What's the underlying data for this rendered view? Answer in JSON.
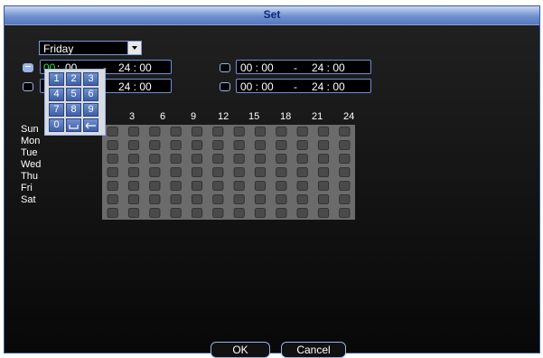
{
  "window": {
    "title": "Set"
  },
  "day_select": {
    "value": "Friday"
  },
  "periods": [
    {
      "enabled": true,
      "start_hour": "00",
      "start_min": "00",
      "sep": "-",
      "end": "24 : 00"
    },
    {
      "enabled": false,
      "start_hour": "",
      "start_min": "",
      "sep": "",
      "end": "24 : 00"
    },
    {
      "enabled": false,
      "start": "00 : 00",
      "sep": "-",
      "end": "24 : 00"
    },
    {
      "enabled": false,
      "start": "00 : 00",
      "sep": "-",
      "end": "24 : 00"
    }
  ],
  "keypad": {
    "keys": [
      "1",
      "2",
      "3",
      "4",
      "5",
      "6",
      "7",
      "8",
      "9",
      "0",
      "space",
      "backspace"
    ]
  },
  "timeline": {
    "hours": [
      "3",
      "6",
      "9",
      "12",
      "15",
      "18",
      "21",
      "24"
    ],
    "days": [
      "Sun",
      "Mon",
      "Tue",
      "Wed",
      "Thu",
      "Fri",
      "Sat"
    ]
  },
  "buttons": {
    "ok": "OK",
    "cancel": "Cancel"
  },
  "colors": {
    "title_bar": "#6f90cf",
    "border": "#9ab3e6",
    "active_digit": "#37e04a",
    "grid": "#6b6b6b"
  }
}
